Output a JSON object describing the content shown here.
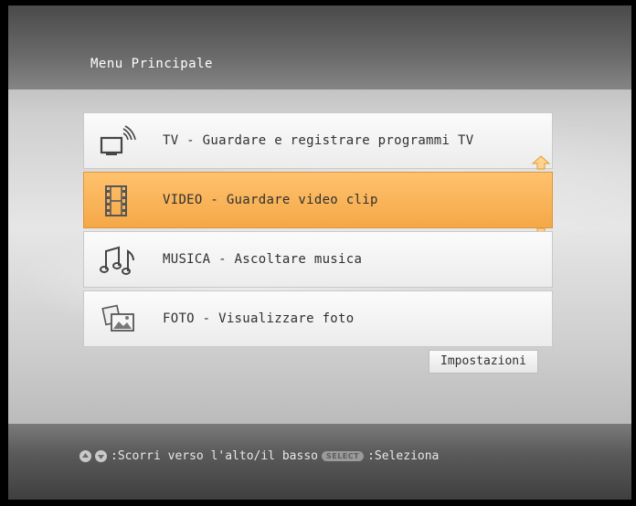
{
  "header": {
    "title": "Menu Principale"
  },
  "menu": {
    "items": [
      {
        "label": "TV - Guardare e registrare programmi TV",
        "icon": "tv-icon"
      },
      {
        "label": "VIDEO - Guardare video clip",
        "icon": "film-icon",
        "selected": true
      },
      {
        "label": "MUSICA - Ascoltare musica",
        "icon": "music-notes-icon"
      },
      {
        "label": "FOTO - Visualizzare foto",
        "icon": "photos-icon"
      }
    ],
    "selected_color": "#f7b04f"
  },
  "settings": {
    "label": "Impostazioni"
  },
  "footer": {
    "scroll_hint": ":Scorri verso l'alto/il basso",
    "select_badge": "SELECT",
    "select_hint": ":Seleziona"
  }
}
